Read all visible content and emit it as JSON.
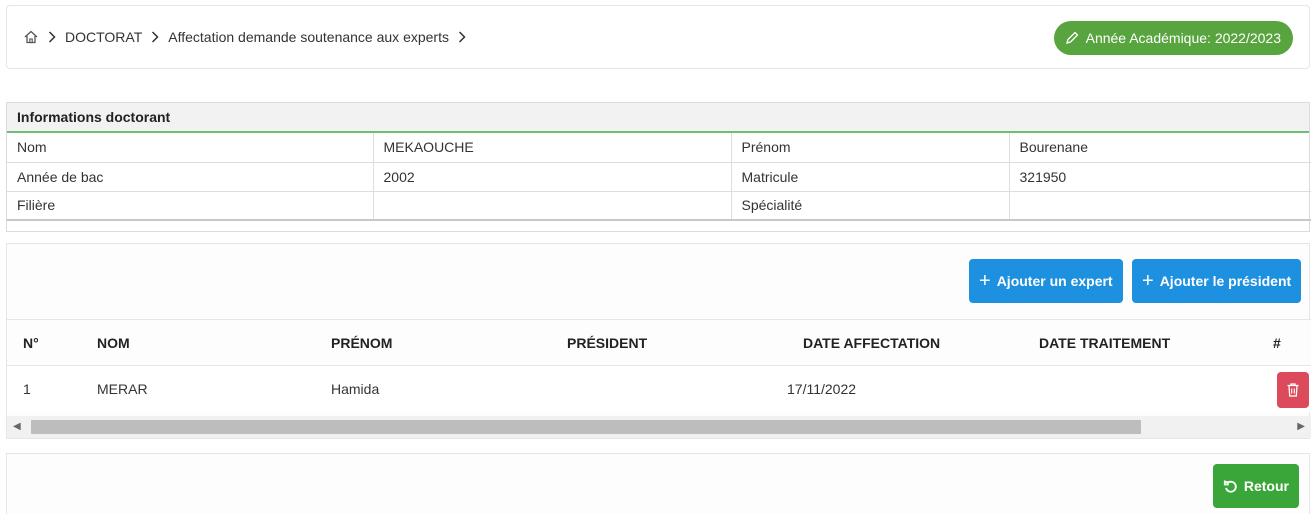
{
  "breadcrumb": {
    "home_icon": "home-icon",
    "items": [
      "DOCTORAT",
      "Affectation demande soutenance aux experts"
    ]
  },
  "academic_year": {
    "label": "Année Académique: 2022/2023",
    "icon": "pencil-icon",
    "color": "#58a43f"
  },
  "info_panel": {
    "title": "Informations doctorant",
    "rows": [
      {
        "label1": "Nom",
        "value1": "MEKAOUCHE",
        "label2": "Prénom",
        "value2": "Bourenane"
      },
      {
        "label1": "Année de bac",
        "value1": "2002",
        "label2": "Matricule",
        "value2": "321950"
      },
      {
        "label1": "Filière",
        "value1": "",
        "label2": "Spécialité",
        "value2": ""
      }
    ]
  },
  "actions": {
    "add_expert": "Ajouter un expert",
    "add_president": "Ajouter le président",
    "button_color": "#1e90e0"
  },
  "experts_table": {
    "columns": [
      "N°",
      "NOM",
      "PRÉNOM",
      "PRÉSIDENT",
      "DATE AFFECTATION",
      "DATE TRAITEMENT",
      "#"
    ],
    "rows": [
      {
        "num": "1",
        "nom": "MERAR",
        "prenom": "Hamida",
        "president": "",
        "date_affectation": "17/11/2022",
        "date_traitement": ""
      }
    ],
    "delete_icon": "trash-icon",
    "delete_color": "#dc4b5c"
  },
  "footer": {
    "back_label": "Retour",
    "back_icon": "undo-icon",
    "back_color": "#3aa63a"
  }
}
